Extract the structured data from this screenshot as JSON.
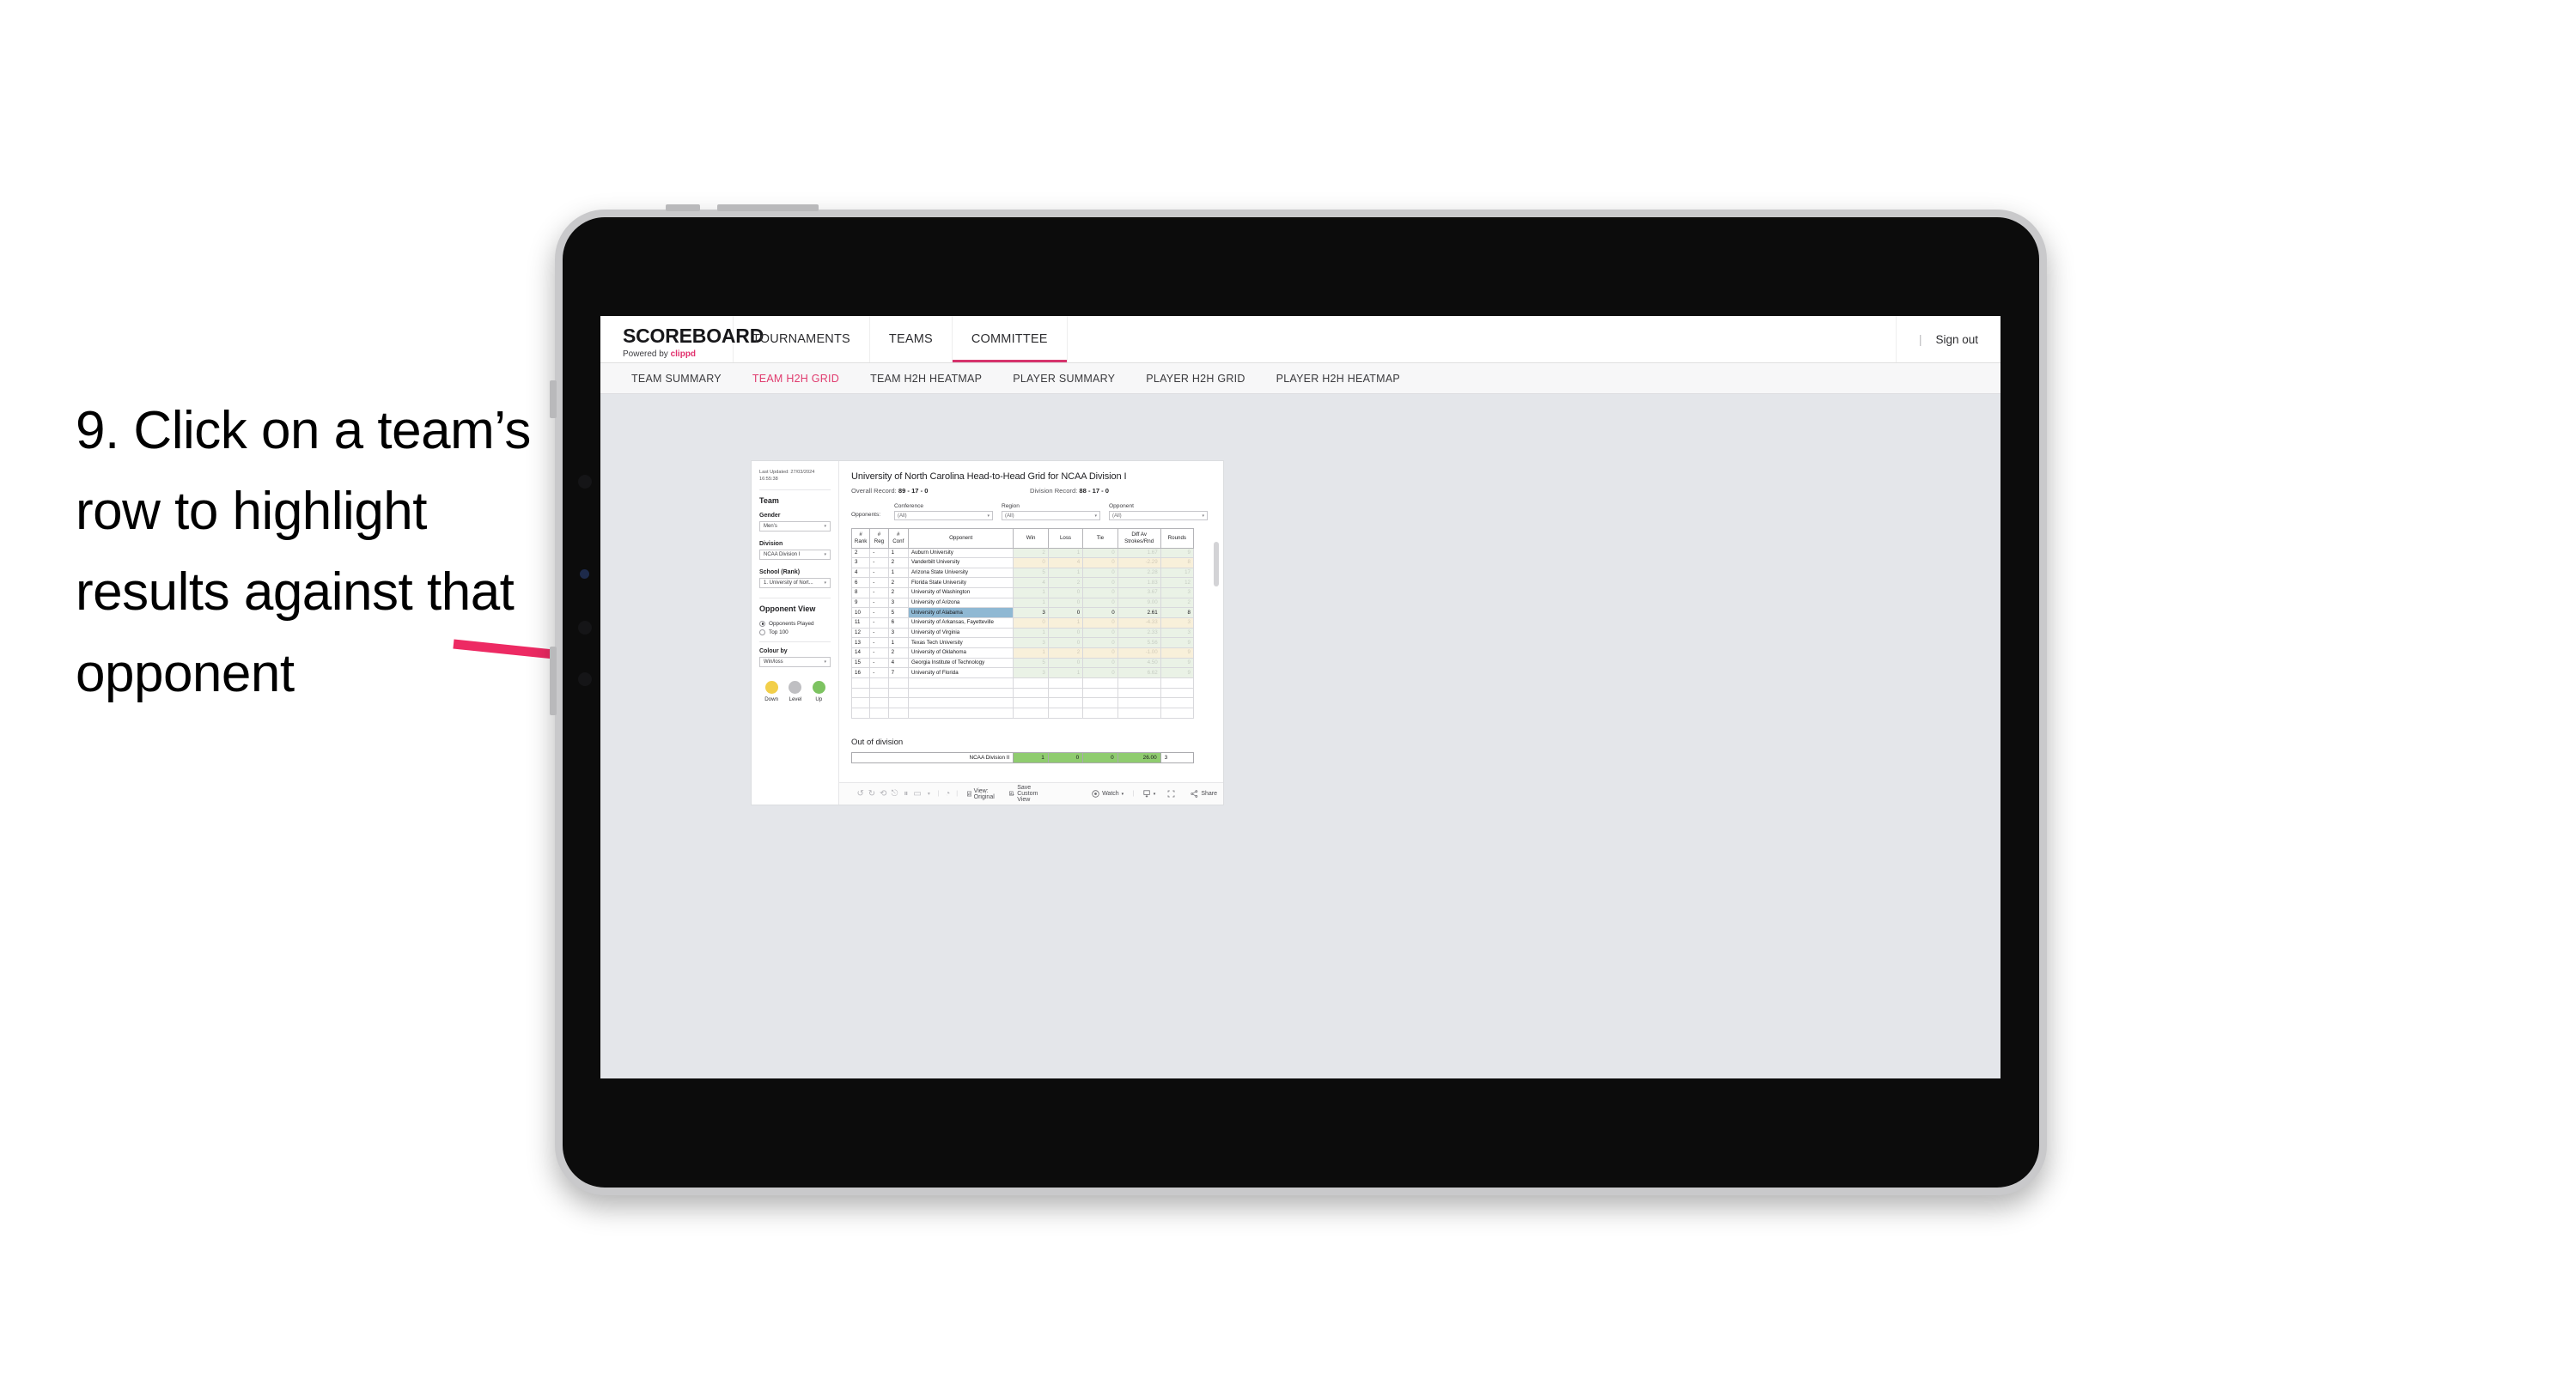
{
  "annotation": {
    "text": "9. Click on a team’s row to highlight results against that opponent",
    "arrow_color": "#ed2a63"
  },
  "app": {
    "brand": {
      "title": "SCOREBOARD",
      "powered_prefix": "Powered by ",
      "powered_brand": "clippd"
    },
    "top_nav": [
      {
        "label": "TOURNAMENTS",
        "active": false
      },
      {
        "label": "TEAMS",
        "active": false
      },
      {
        "label": "COMMITTEE",
        "active": true
      }
    ],
    "top_right": {
      "divider": "|",
      "sign_out": "Sign out"
    },
    "sub_nav": [
      {
        "label": "TEAM SUMMARY",
        "active": false
      },
      {
        "label": "TEAM H2H GRID",
        "active": true
      },
      {
        "label": "TEAM H2H HEATMAP",
        "active": false
      },
      {
        "label": "PLAYER SUMMARY",
        "active": false
      },
      {
        "label": "PLAYER H2H GRID",
        "active": false
      },
      {
        "label": "PLAYER H2H HEATMAP",
        "active": false
      }
    ],
    "accent_color": "#d6336c"
  },
  "sidebar": {
    "last_updated": "Last Updated: 27/03/2024 16:55:38",
    "team_heading": "Team",
    "gender": {
      "label": "Gender",
      "value": "Men’s"
    },
    "division": {
      "label": "Division",
      "value": "NCAA Division I"
    },
    "school": {
      "label": "School (Rank)",
      "value": "1. University of Nort..."
    },
    "opponent_view": {
      "heading": "Opponent View",
      "options": [
        {
          "label": "Opponents Played",
          "selected": true
        },
        {
          "label": "Top 100",
          "selected": false
        }
      ]
    },
    "colour_by": {
      "label": "Colour by",
      "value": "Win/loss"
    },
    "legend": [
      {
        "label": "Down",
        "color": "#f2cf4a"
      },
      {
        "label": "Level",
        "color": "#bfbfc2"
      },
      {
        "label": "Up",
        "color": "#7dc361"
      }
    ]
  },
  "main": {
    "title": "University of North Carolina Head-to-Head Grid for NCAA Division I",
    "overall_record_label": "Overall Record: ",
    "overall_record_value": "89 - 17 - 0",
    "division_record_label": "Division Record: ",
    "division_record_value": "88 - 17 - 0",
    "opponents_label": "Opponents:",
    "filters": [
      {
        "label": "Conference",
        "value": "(All)"
      },
      {
        "label": "Region",
        "value": "(All)"
      },
      {
        "label": "Opponent",
        "value": "(All)"
      }
    ],
    "table": {
      "headers": [
        "#\nRank",
        "#\nReg",
        "#\nConf",
        "Opponent",
        "Win",
        "Loss",
        "Tie",
        "Diff Av\nStrokes/Rnd",
        "Rounds"
      ],
      "header_rank_l1": "#",
      "header_rank_l2": "Rank",
      "header_reg_l1": "#",
      "header_reg_l2": "Reg",
      "header_conf_l1": "#",
      "header_conf_l2": "Conf",
      "header_opponent": "Opponent",
      "header_win": "Win",
      "header_loss": "Loss",
      "header_tie": "Tie",
      "header_diff_l1": "Diff Av",
      "header_diff_l2": "Strokes/Rnd",
      "header_rounds": "Rounds",
      "rows": [
        {
          "rank": "2",
          "reg": "-",
          "conf": "1",
          "opponent": "Auburn University",
          "win": "2",
          "loss": "1",
          "tie": "0",
          "diff": "1.67",
          "rounds": "9",
          "state": "win",
          "highlight": false
        },
        {
          "rank": "3",
          "reg": "-",
          "conf": "2",
          "opponent": "Vanderbilt University",
          "win": "0",
          "loss": "4",
          "tie": "0",
          "diff": "-2.29",
          "rounds": "8",
          "state": "loss",
          "highlight": false
        },
        {
          "rank": "4",
          "reg": "-",
          "conf": "1",
          "opponent": "Arizona State University",
          "win": "5",
          "loss": "1",
          "tie": "0",
          "diff": "2.28",
          "rounds": "17",
          "state": "win",
          "highlight": false
        },
        {
          "rank": "6",
          "reg": "-",
          "conf": "2",
          "opponent": "Florida State University",
          "win": "4",
          "loss": "2",
          "tie": "0",
          "diff": "1.83",
          "rounds": "12",
          "state": "win",
          "highlight": false
        },
        {
          "rank": "8",
          "reg": "-",
          "conf": "2",
          "opponent": "University of Washington",
          "win": "1",
          "loss": "0",
          "tie": "0",
          "diff": "3.67",
          "rounds": "3",
          "state": "win",
          "highlight": false
        },
        {
          "rank": "9",
          "reg": "-",
          "conf": "3",
          "opponent": "University of Arizona",
          "win": "1",
          "loss": "0",
          "tie": "0",
          "diff": "9.00",
          "rounds": "2",
          "state": "win",
          "highlight": false
        },
        {
          "rank": "10",
          "reg": "-",
          "conf": "5",
          "opponent": "University of Alabama",
          "win": "3",
          "loss": "0",
          "tie": "0",
          "diff": "2.61",
          "rounds": "8",
          "state": "win",
          "highlight": true
        },
        {
          "rank": "11",
          "reg": "-",
          "conf": "6",
          "opponent": "University of Arkansas, Fayetteville",
          "win": "0",
          "loss": "1",
          "tie": "0",
          "diff": "-4.33",
          "rounds": "3",
          "state": "loss",
          "highlight": false
        },
        {
          "rank": "12",
          "reg": "-",
          "conf": "3",
          "opponent": "University of Virginia",
          "win": "1",
          "loss": "0",
          "tie": "0",
          "diff": "2.33",
          "rounds": "3",
          "state": "win",
          "highlight": false
        },
        {
          "rank": "13",
          "reg": "-",
          "conf": "1",
          "opponent": "Texas Tech University",
          "win": "3",
          "loss": "0",
          "tie": "0",
          "diff": "5.56",
          "rounds": "9",
          "state": "win",
          "highlight": false
        },
        {
          "rank": "14",
          "reg": "-",
          "conf": "2",
          "opponent": "University of Oklahoma",
          "win": "1",
          "loss": "2",
          "tie": "0",
          "diff": "-1.00",
          "rounds": "9",
          "state": "loss",
          "highlight": false
        },
        {
          "rank": "15",
          "reg": "-",
          "conf": "4",
          "opponent": "Georgia Institute of Technology",
          "win": "5",
          "loss": "0",
          "tie": "0",
          "diff": "4.50",
          "rounds": "9",
          "state": "win",
          "highlight": false
        },
        {
          "rank": "16",
          "reg": "-",
          "conf": "7",
          "opponent": "University of Florida",
          "win": "3",
          "loss": "1",
          "tie": "0",
          "diff": "6.62",
          "rounds": "9",
          "state": "win",
          "highlight": false
        }
      ]
    },
    "out_of_division": {
      "title": "Out of division",
      "row": {
        "name": "NCAA Division II",
        "win": "1",
        "loss": "0",
        "tie": "0",
        "diff": "26.00",
        "rounds": "3"
      }
    },
    "toolbar": {
      "view_label": "View: Original",
      "save_label": "Save Custom View",
      "watch_label": "Watch",
      "share_label": "Share",
      "caret": "▾",
      "divider": "|"
    }
  },
  "colors": {
    "highlight_row": "#8fb8d3",
    "highlight_num": "#8fcc6f",
    "win_tint": "#eaf2e6",
    "loss_tint": "#f8f0da"
  }
}
